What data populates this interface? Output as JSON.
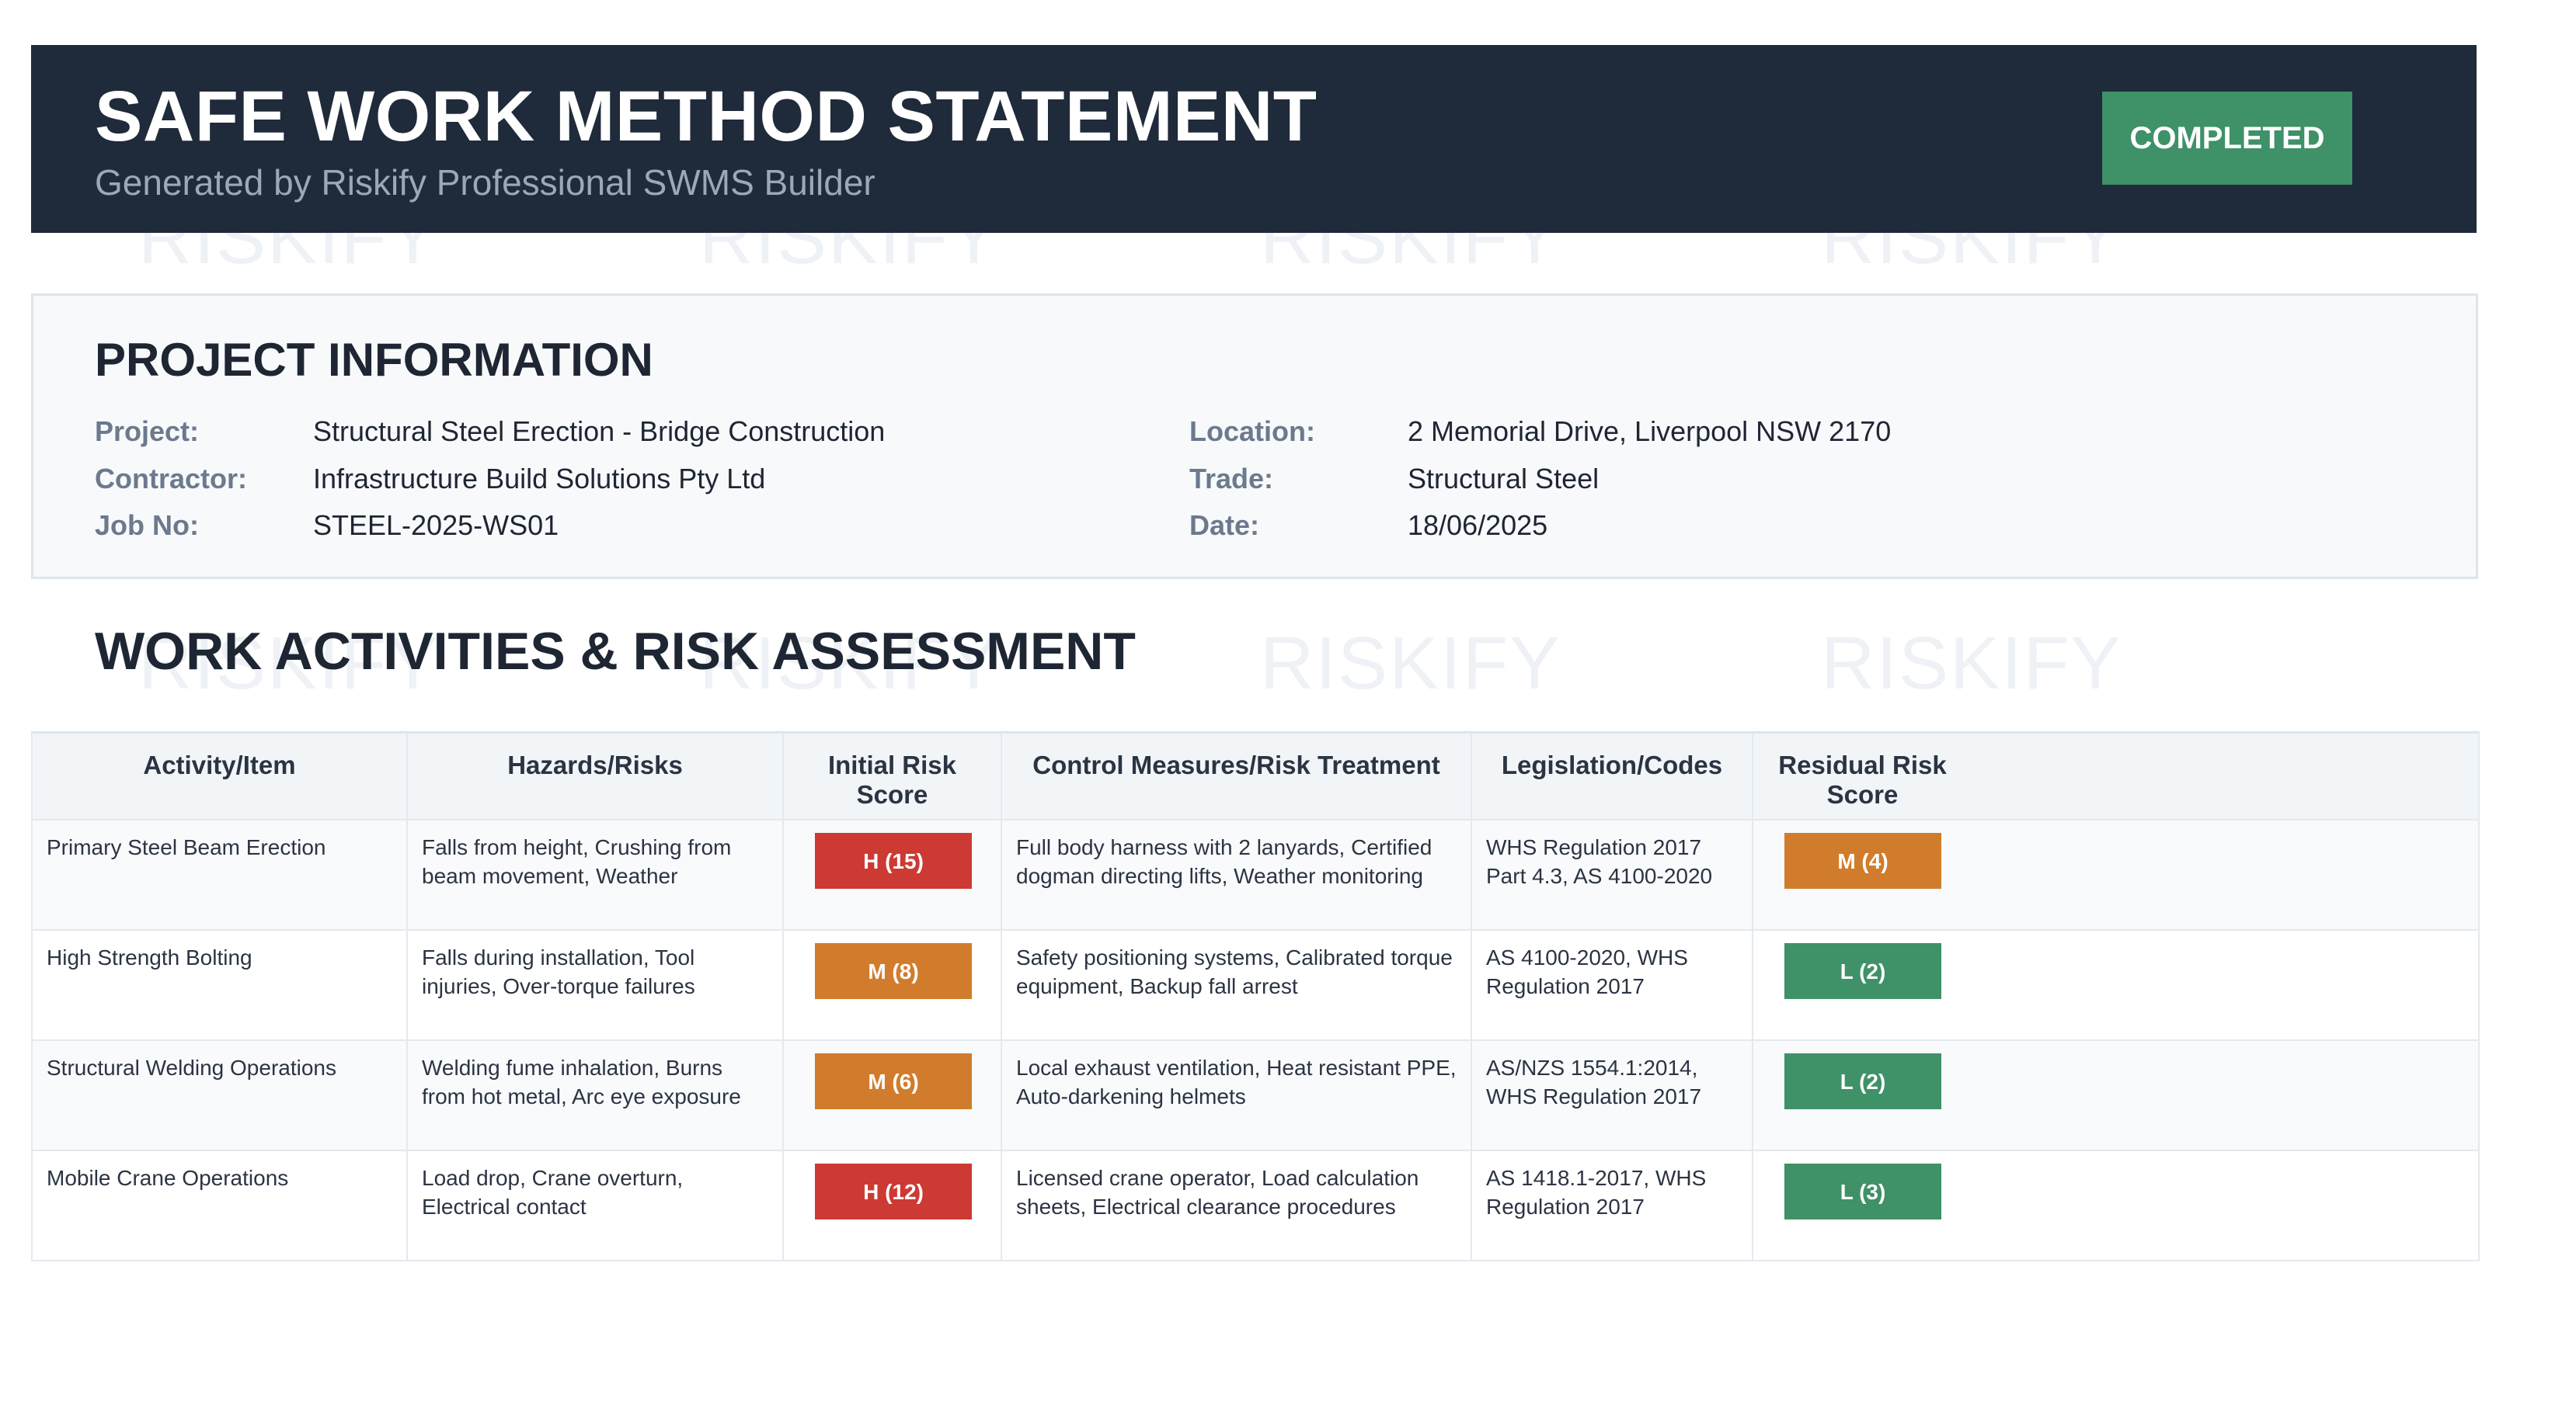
{
  "header": {
    "title": "SAFE WORK METHOD STATEMENT",
    "subtitle": "Generated by Riskify Professional SWMS Builder",
    "status": "COMPLETED"
  },
  "watermark": {
    "text": "RISKIFY"
  },
  "project": {
    "section_title": "PROJECT INFORMATION",
    "fields": [
      {
        "label": "Project:",
        "value": "Structural Steel Erection - Bridge Construction"
      },
      {
        "label": "Contractor:",
        "value": "Infrastructure Build Solutions Pty Ltd"
      },
      {
        "label": "Job No:",
        "value": "STEEL-2025-WS01"
      },
      {
        "label": "Location:",
        "value": "2 Memorial Drive, Liverpool NSW 2170"
      },
      {
        "label": "Trade:",
        "value": "Structural Steel"
      },
      {
        "label": "Date:",
        "value": "18/06/2025"
      }
    ]
  },
  "activities": {
    "section_title": "WORK ACTIVITIES & RISK ASSESSMENT",
    "columns": [
      "Activity/Item",
      "Hazards/Risks",
      "Initial Risk Score",
      "Control Measures/Risk Treatment",
      "Legislation/Codes",
      "Residual Risk Score"
    ],
    "rows": [
      {
        "activity": "Primary Steel Beam Erection",
        "hazards": "Falls from height, Crushing from beam movement, Weather",
        "initial_risk": "H (15)",
        "initial_level": "H",
        "controls": "Full body harness with 2 lanyards, Certified dogman directing lifts, Weather monitoring",
        "legislation": "WHS Regulation 2017 Part 4.3, AS 4100-2020",
        "residual_risk": "M (4)",
        "residual_level": "M"
      },
      {
        "activity": "High Strength Bolting",
        "hazards": "Falls during installation, Tool injuries, Over-torque failures",
        "initial_risk": "M (8)",
        "initial_level": "M",
        "controls": "Safety positioning systems, Calibrated torque equipment, Backup fall arrest",
        "legislation": "AS 4100-2020, WHS Regulation 2017",
        "residual_risk": "L (2)",
        "residual_level": "L"
      },
      {
        "activity": "Structural Welding Operations",
        "hazards": "Welding fume inhalation, Burns from hot metal, Arc eye exposure",
        "initial_risk": "M (6)",
        "initial_level": "M",
        "controls": "Local exhaust ventilation, Heat resistant PPE, Auto-darkening helmets",
        "legislation": "AS/NZS 1554.1:2014, WHS Regulation 2017",
        "residual_risk": "L (2)",
        "residual_level": "L"
      },
      {
        "activity": "Mobile Crane Operations",
        "hazards": "Load drop, Crane overturn, Electrical contact",
        "initial_risk": "H (12)",
        "initial_level": "H",
        "controls": "Licensed crane operator, Load calculation sheets, Electrical clearance procedures",
        "legislation": "AS 1418.1-2017, WHS Regulation 2017",
        "residual_risk": "L (3)",
        "residual_level": "L"
      }
    ]
  },
  "colors": {
    "header_bg": "#1f2a3a",
    "status_green": "#3f9168",
    "risk_high": "#cc3a33",
    "risk_medium": "#d17c2c",
    "risk_low": "#3f9168"
  }
}
